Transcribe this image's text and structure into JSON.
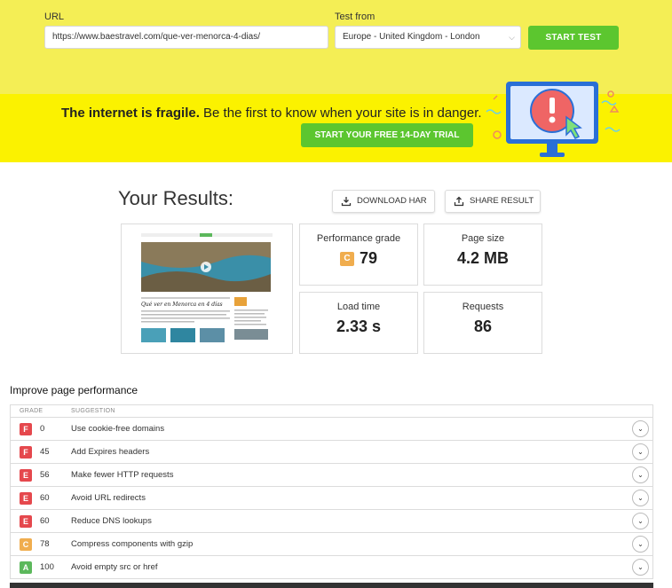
{
  "form": {
    "url_label": "URL",
    "url_value": "https://www.baestravel.com/que-ver-menorca-4-dias/",
    "location_label": "Test from",
    "location_value": "Europe - United Kingdom - London",
    "start_label": "START TEST"
  },
  "banner": {
    "headline_bold": "The internet is fragile.",
    "headline_rest": " Be the first to know when your site is in danger.",
    "trial_label": "START YOUR FREE 14-DAY TRIAL"
  },
  "results": {
    "title": "Your Results:",
    "download_label": "DOWNLOAD HAR",
    "share_label": "SHARE RESULT",
    "performance": {
      "label": "Performance grade",
      "grade": "C",
      "value": "79"
    },
    "page_size": {
      "label": "Page size",
      "value": "4.2 MB"
    },
    "load_time": {
      "label": "Load time",
      "value": "2.33 s"
    },
    "requests": {
      "label": "Requests",
      "value": "86"
    }
  },
  "improve": {
    "title": "Improve page performance",
    "col_grade": "GRADE",
    "col_suggestion": "SUGGESTION",
    "rows": [
      {
        "grade": "F",
        "score": "0",
        "suggestion": "Use cookie-free domains",
        "color": "#e5484d"
      },
      {
        "grade": "F",
        "score": "45",
        "suggestion": "Add Expires headers",
        "color": "#e5484d"
      },
      {
        "grade": "E",
        "score": "56",
        "suggestion": "Make fewer HTTP requests",
        "color": "#e5484d"
      },
      {
        "grade": "E",
        "score": "60",
        "suggestion": "Avoid URL redirects",
        "color": "#e5484d"
      },
      {
        "grade": "E",
        "score": "60",
        "suggestion": "Reduce DNS lookups",
        "color": "#e5484d"
      },
      {
        "grade": "C",
        "score": "78",
        "suggestion": "Compress components with gzip",
        "color": "#f0ad4e"
      },
      {
        "grade": "A",
        "score": "100",
        "suggestion": "Avoid empty src or href",
        "color": "#5cb85c"
      }
    ]
  },
  "thumbnail": {
    "article_title": "Qué ver en Menorca en 4 días"
  },
  "colors": {
    "top_bg": "#f4ee55",
    "banner_bg": "#fbf200",
    "accent_green": "#5cc62f"
  }
}
